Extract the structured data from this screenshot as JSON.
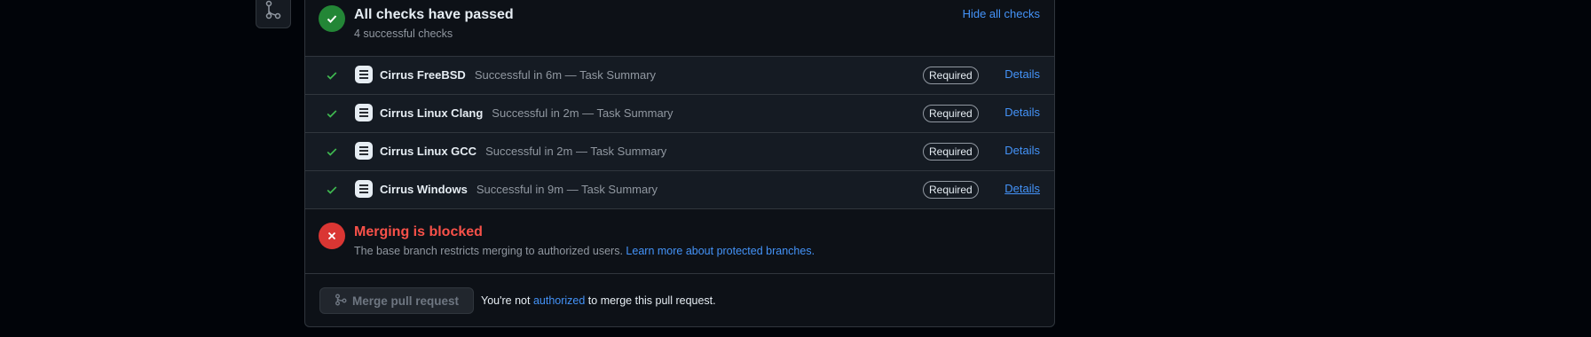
{
  "summary": {
    "title": "All checks have passed",
    "subtitle": "4 successful checks",
    "hide_link": "Hide all checks"
  },
  "checks": [
    {
      "name": "Cirrus FreeBSD",
      "desc": "Successful in 6m — Task Summary",
      "badge": "Required",
      "details": "Details"
    },
    {
      "name": "Cirrus Linux Clang",
      "desc": "Successful in 2m — Task Summary",
      "badge": "Required",
      "details": "Details"
    },
    {
      "name": "Cirrus Linux GCC",
      "desc": "Successful in 2m — Task Summary",
      "badge": "Required",
      "details": "Details"
    },
    {
      "name": "Cirrus Windows",
      "desc": "Successful in 9m — Task Summary",
      "badge": "Required",
      "details": "Details"
    }
  ],
  "blocked": {
    "title": "Merging is blocked",
    "message": "The base branch restricts merging to authorized users.",
    "link": "Learn more about protected branches."
  },
  "merge": {
    "button_label": "Merge pull request",
    "note_prefix": "You're not",
    "note_link": "authorized",
    "note_suffix": "to merge this pull request."
  },
  "colors": {
    "success": "#238636",
    "danger": "#da3633",
    "link": "#4493f8",
    "background": "#0d1117"
  },
  "icons": {
    "timeline": "git-branch-icon",
    "success": "check-circle-icon",
    "row": "check-icon",
    "app": "cirrus-app-icon",
    "blocked": "x-circle-icon",
    "merge": "git-merge-icon"
  }
}
